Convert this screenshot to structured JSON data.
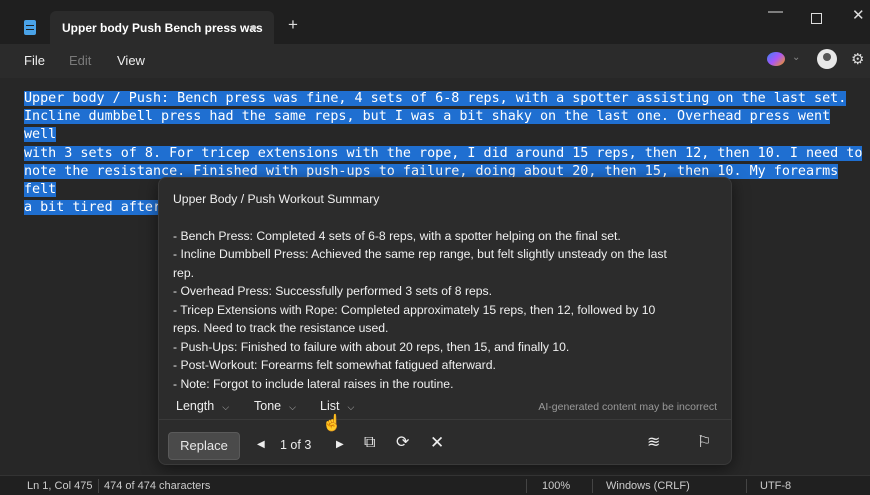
{
  "window": {
    "tab_title": "Upper body  Push Bench press was",
    "tab_modified_dot": "●",
    "new_tab": "+",
    "minimize": "—",
    "close": "✕"
  },
  "menu": {
    "file": "File",
    "edit": "Edit",
    "view": "View"
  },
  "editor": {
    "text_lines": [
      "Upper body / Push: Bench press was fine, 4 sets of 6-8 reps, with a spotter assisting on the last set.",
      "Incline dumbbell press had the same reps, but I was a bit shaky on the last one. Overhead press went well",
      "with 3 sets of 8. For tricep extensions with the rope, I did around 15 reps, then 12, then 10. I need to",
      "note the resistance. Finished with push-ups to failure, doing about 20, then 15, then 10. My forearms felt",
      "a bit tired afterward. I forgot to do lateral raises."
    ]
  },
  "rewrite_panel": {
    "title": "Upper Body / Push Workout Summary",
    "lines": [
      "- Bench Press: Completed 4 sets of 6-8 reps, with a spotter helping on the final set.",
      "- Incline Dumbbell Press: Achieved the same rep range, but felt slightly unsteady on the last",
      "rep.",
      "- Overhead Press: Successfully performed 3 sets of 8 reps.",
      "- Tricep Extensions with Rope: Completed approximately 15 reps, then 12, followed by 10",
      "reps. Need to track the resistance used.",
      "- Push-Ups: Finished to failure with about 20 reps, then 15, and finally 10.",
      "- Post-Workout: Forearms felt somewhat fatigued afterward.",
      "- Note: Forgot to include lateral raises in the routine."
    ],
    "options": {
      "length": "Length",
      "tone": "Tone",
      "format": "List"
    },
    "disclaimer": "AI-generated content may be incorrect",
    "replace_label": "Replace",
    "counter": "1 of 3"
  },
  "status_bar": {
    "position": "Ln 1, Col 475",
    "characters": "474 of 474 characters",
    "zoom": "100%",
    "line_ending": "Windows (CRLF)",
    "encoding": "UTF-8"
  },
  "colors": {
    "selection": "#1f6fd1",
    "background": "#272727"
  }
}
